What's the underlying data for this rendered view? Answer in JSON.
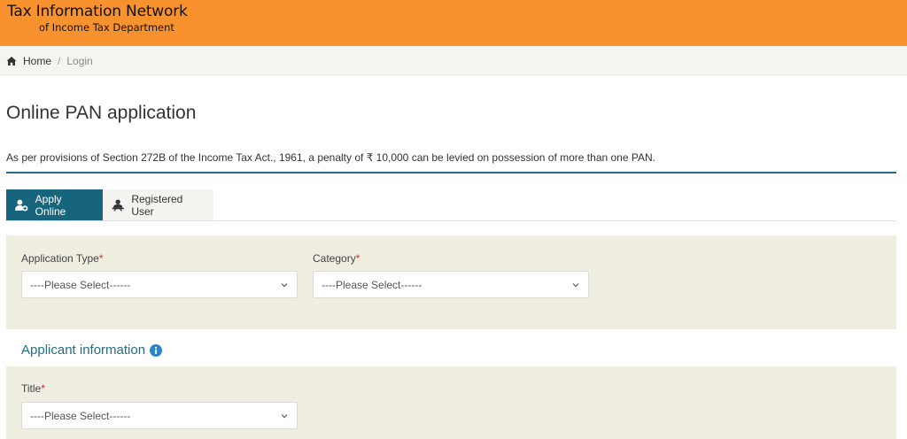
{
  "header": {
    "brand_line1": "Tax Information Network",
    "brand_line2": "of Income Tax Department",
    "color": "#f7922f"
  },
  "breadcrumb": {
    "home_icon": "home-icon",
    "home_label": "Home",
    "separator": "/",
    "current_label": "Login"
  },
  "page": {
    "title": "Online PAN application",
    "notice": "As per provisions of Section 272B of the Income Tax Act., 1961, a penalty of ₹ 10,000 can be levied on possession of more than one PAN.",
    "accent": "#17657d"
  },
  "tabs": [
    {
      "label": "Apply Online",
      "icon": "user-add-icon",
      "active": true
    },
    {
      "label": "Registered User",
      "icon": "user-login-icon",
      "active": false
    }
  ],
  "form": {
    "application_type": {
      "label": "Application Type",
      "required": "*",
      "value": "----Please Select------"
    },
    "category": {
      "label": "Category",
      "required": "*",
      "value": "----Please Select------"
    },
    "applicant_section_title": "Applicant information",
    "title": {
      "label": "Title",
      "required": "*",
      "value": "----Please Select------"
    }
  }
}
